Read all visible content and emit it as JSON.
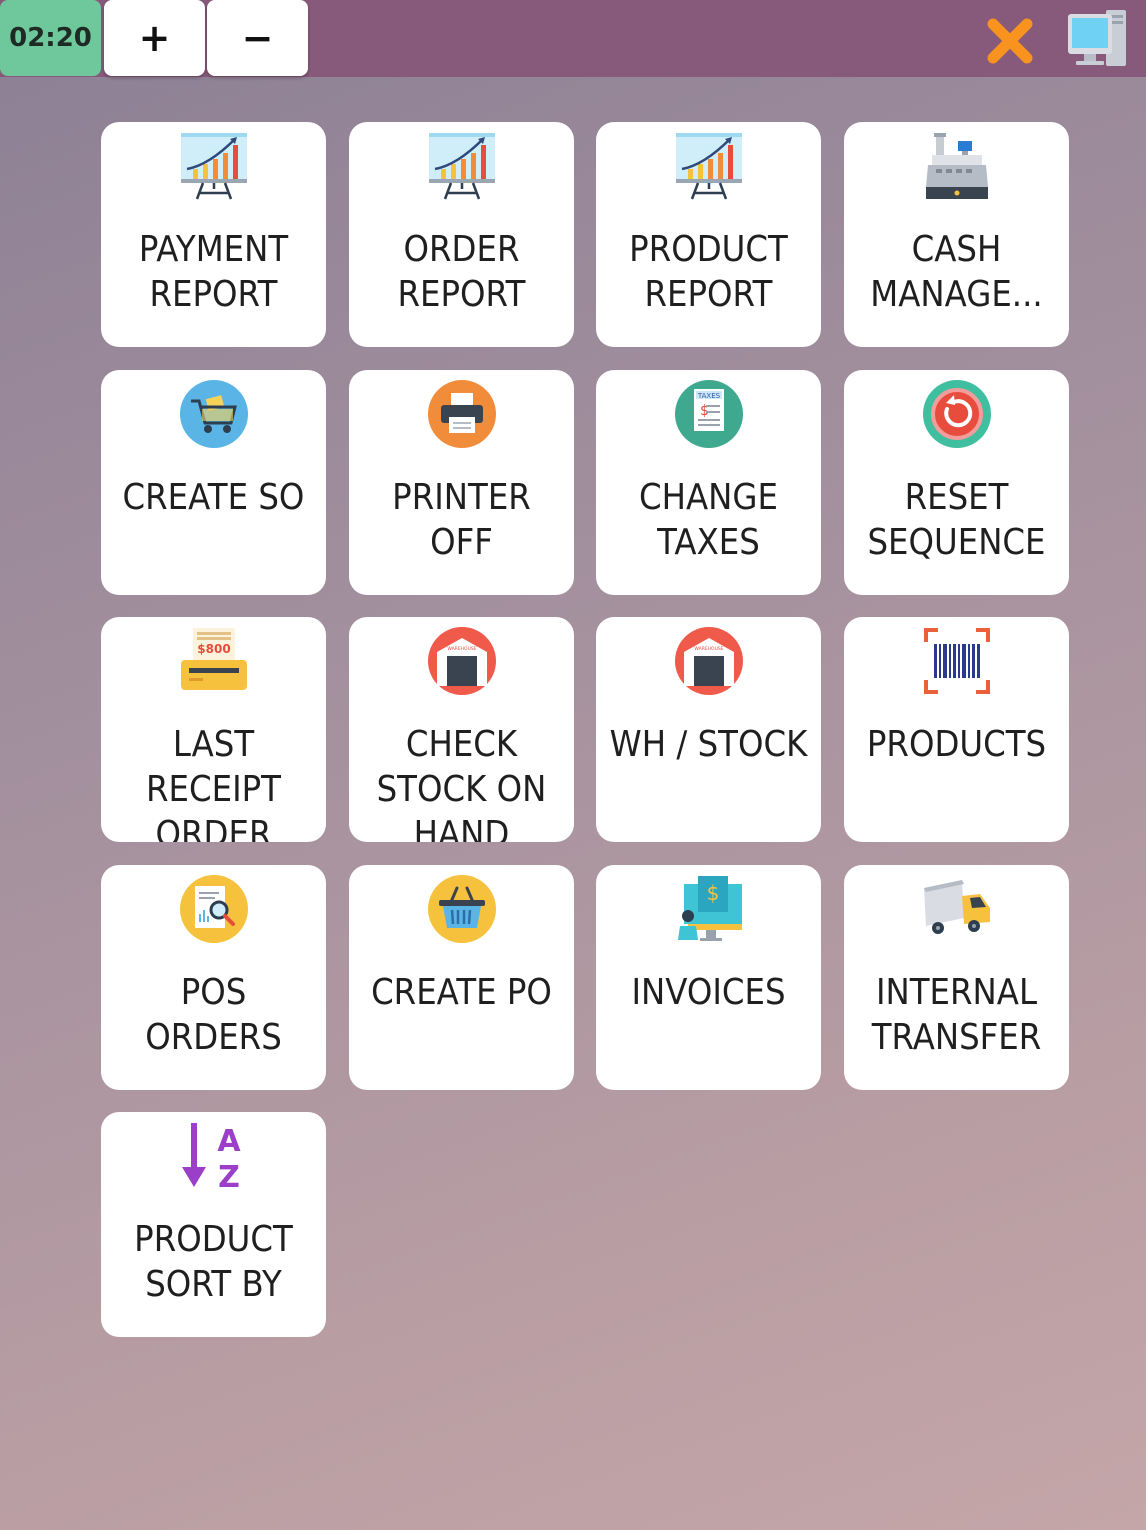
{
  "topbar": {
    "clock": "02:20",
    "zoom_in_label": "+",
    "zoom_out_label": "−",
    "close_icon": "close-x-icon",
    "display_icon": "computer-screen-icon",
    "colors": {
      "bar": "#875a7b",
      "clock": "#6ec89b",
      "close": "#f7931e"
    }
  },
  "tiles": [
    {
      "label": "PAYMENT REPORT",
      "icon": "chart-growth-icon"
    },
    {
      "label": "ORDER REPORT",
      "icon": "chart-growth-icon"
    },
    {
      "label": "PRODUCT REPORT",
      "icon": "chart-growth-icon"
    },
    {
      "label": "CASH MANAGE...",
      "icon": "cash-register-icon"
    },
    {
      "label": "CREATE SO",
      "icon": "shopping-cart-icon"
    },
    {
      "label": "PRINTER OFF",
      "icon": "printer-icon"
    },
    {
      "label": "CHANGE TAXES",
      "icon": "tax-document-icon"
    },
    {
      "label": "RESET SEQUENCE",
      "icon": "reset-power-icon"
    },
    {
      "label": "LAST RECEIPT ORDER",
      "icon": "receipt-printer-icon",
      "receipt_amount": "$800"
    },
    {
      "label": "CHECK STOCK ON HAND",
      "icon": "warehouse-icon",
      "sign": "WAREHOUSE"
    },
    {
      "label": "WH / STOCK",
      "icon": "warehouse-icon",
      "sign": "WAREHOUSE"
    },
    {
      "label": "PRODUCTS",
      "icon": "barcode-icon"
    },
    {
      "label": "POS ORDERS",
      "icon": "document-search-icon"
    },
    {
      "label": "CREATE PO",
      "icon": "shopping-basket-icon"
    },
    {
      "label": "INVOICES",
      "icon": "invoice-dollar-icon"
    },
    {
      "label": "INTERNAL TRANSFER",
      "icon": "delivery-truck-icon"
    },
    {
      "label": "PRODUCT SORT BY",
      "icon": "sort-az-icon"
    }
  ]
}
